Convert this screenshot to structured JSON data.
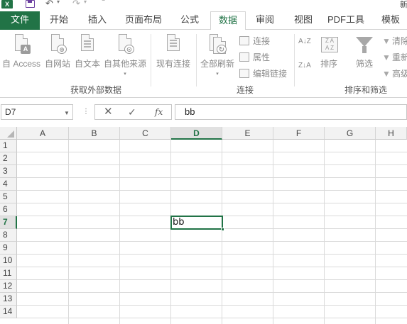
{
  "titlebar": {
    "app_logo": "X",
    "title_fragment": "新",
    "icons": [
      "excel-logo-icon",
      "save-icon",
      "undo-icon",
      "redo-icon",
      "customize-icon"
    ]
  },
  "tabs": [
    {
      "label": "文件"
    },
    {
      "label": "开始"
    },
    {
      "label": "插入"
    },
    {
      "label": "页面布局"
    },
    {
      "label": "公式"
    },
    {
      "label": "数据"
    },
    {
      "label": "审阅"
    },
    {
      "label": "视图"
    },
    {
      "label": "PDF工具"
    },
    {
      "label": "模板"
    }
  ],
  "ribbon": {
    "get_external": {
      "group_label": "获取外部数据",
      "access": "自 Access",
      "web": "自网站",
      "text": "自文本",
      "other": "自其他来源",
      "existing": "现有连接",
      "access_badge": "A",
      "text_badge": "≡"
    },
    "connections": {
      "group_label": "连接",
      "refresh_all": "全部刷新",
      "connections": "连接",
      "properties": "属性",
      "edit_links": "编辑链接"
    },
    "sort_filter": {
      "group_label": "排序和筛选",
      "sort_az": "A↓Z",
      "sort_za": "Z↓A",
      "sort": "排序",
      "filter": "筛选",
      "clear": "清除",
      "reapply": "重新",
      "advanced": "高级"
    }
  },
  "formula_bar": {
    "name_box": "D7",
    "cancel_symbol": "✕",
    "enter_symbol": "✓",
    "fx_symbol": "fx",
    "content": "bb"
  },
  "grid": {
    "columns": [
      "A",
      "B",
      "C",
      "D",
      "E",
      "F",
      "G",
      "H"
    ],
    "rows": [
      "1",
      "2",
      "3",
      "4",
      "5",
      "6",
      "7",
      "8",
      "9",
      "10",
      "11",
      "12",
      "13",
      "14"
    ],
    "selected_column": "D",
    "selected_row": "7",
    "active_cell_value": "bb"
  },
  "colors": {
    "accent": "#217346",
    "ribbon_icon": "#a8a8a8"
  }
}
